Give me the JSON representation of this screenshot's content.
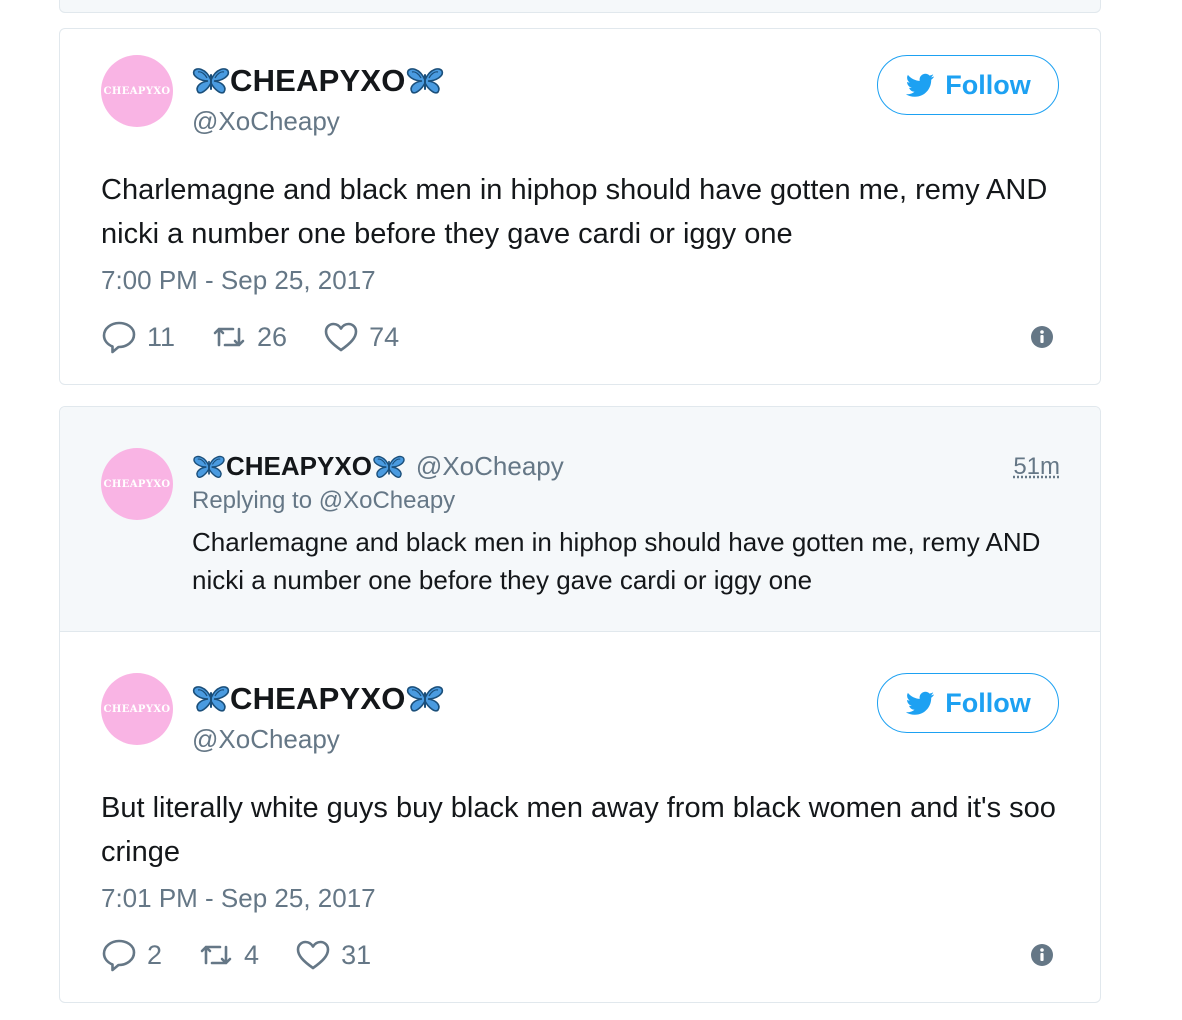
{
  "tweets": [
    {
      "avatar_text": "CHEAPYXO",
      "display_name": "CHEAPYXO",
      "handle": "@XoCheapy",
      "follow_label": "Follow",
      "text": "Charlemagne and black men in hiphop should have gotten me, remy AND nicki a number one before they gave cardi or iggy one",
      "timestamp": "7:00 PM - Sep 25, 2017",
      "replies": "11",
      "retweets": "26",
      "likes": "74"
    },
    {
      "avatar_text": "CHEAPYXO",
      "display_name": "CHEAPYXO",
      "handle": "@XoCheapy",
      "follow_label": "Follow",
      "text": "But literally white guys buy black men away from black women and it's soo cringe",
      "timestamp": "7:01 PM - Sep 25, 2017",
      "replies": "2",
      "retweets": "4",
      "likes": "31"
    }
  ],
  "reply_context": {
    "avatar_text": "CHEAPYXO",
    "display_name": "CHEAPYXO",
    "handle": "@XoCheapy",
    "time_ago": "51m",
    "replying_to": "Replying to @XoCheapy",
    "text": "Charlemagne and black men in hiphop should have gotten me, remy AND nicki a number one before they gave cardi or iggy one"
  },
  "colors": {
    "twitter_blue": "#1da1f2",
    "secondary_text": "#657786",
    "avatar_pink": "#f9b4e4",
    "butterfly_blue": "#3b8fd6"
  },
  "icons": [
    "butterfly-emoji",
    "twitter-bird-icon",
    "reply-icon",
    "retweet-icon",
    "like-icon",
    "info-icon"
  ]
}
